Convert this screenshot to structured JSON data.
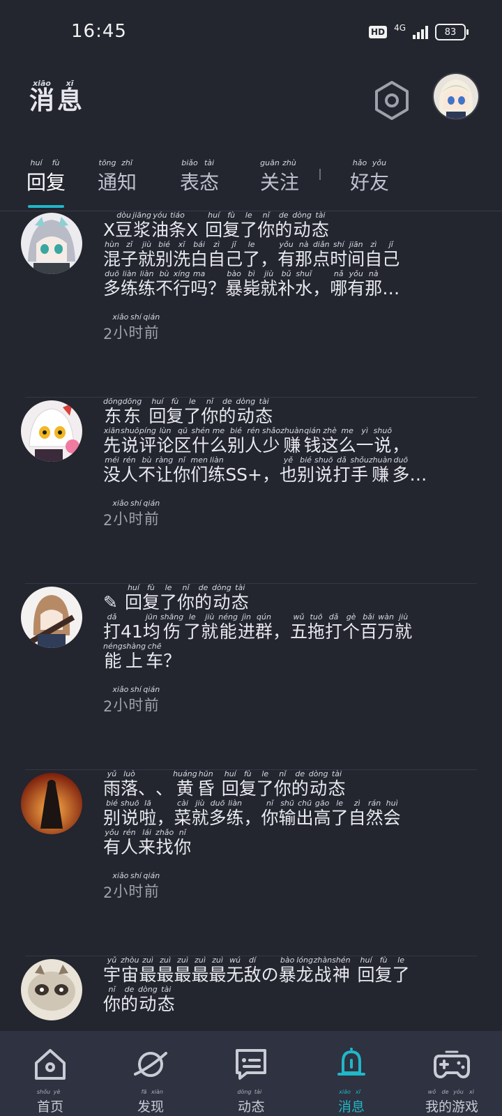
{
  "status_bar": {
    "time": "16:45",
    "hd": "HD",
    "network": "4G",
    "battery": "83"
  },
  "header": {
    "title": [
      {
        "char": "消",
        "py": "xiāo"
      },
      {
        "char": "息",
        "py": "xī"
      }
    ]
  },
  "tabs": [
    {
      "chars": [
        {
          "char": "回",
          "py": "huí"
        },
        {
          "char": "复",
          "py": "fù"
        }
      ],
      "active": true
    },
    {
      "chars": [
        {
          "char": "通",
          "py": "tōng"
        },
        {
          "char": "知",
          "py": "zhī"
        }
      ],
      "active": false
    },
    {
      "chars": [
        {
          "char": "表",
          "py": "biǎo"
        },
        {
          "char": "态",
          "py": "tài"
        }
      ],
      "active": false
    },
    {
      "chars": [
        {
          "char": "关",
          "py": "guān"
        },
        {
          "char": "注",
          "py": "zhù"
        }
      ],
      "active": false
    },
    {
      "chars": [
        {
          "char": "好",
          "py": "hǎo"
        },
        {
          "char": "友",
          "py": "yǒu"
        }
      ],
      "active": false
    }
  ],
  "messages": [
    {
      "lines": [
        [
          {
            "char": "X",
            "py": ""
          },
          {
            "char": "豆",
            "py": "dòu"
          },
          {
            "char": "浆",
            "py": "jiāng"
          },
          {
            "char": "油",
            "py": "yóu"
          },
          {
            "char": "条",
            "py": "tiáo"
          },
          {
            "char": "X",
            "py": ""
          },
          {
            "char": " ",
            "py": ""
          },
          {
            "char": "回",
            "py": "huí"
          },
          {
            "char": "复",
            "py": "fù"
          },
          {
            "char": "了",
            "py": "le"
          },
          {
            "char": "你",
            "py": "nǐ"
          },
          {
            "char": "的",
            "py": "de"
          },
          {
            "char": "动",
            "py": "dòng"
          },
          {
            "char": "态",
            "py": "tài"
          }
        ],
        [
          {
            "char": "混",
            "py": "hùn"
          },
          {
            "char": "子",
            "py": "zǐ"
          },
          {
            "char": "就",
            "py": "jiù"
          },
          {
            "char": "别",
            "py": "bié"
          },
          {
            "char": "洗",
            "py": "xǐ"
          },
          {
            "char": "白",
            "py": "bái"
          },
          {
            "char": "自",
            "py": "zì"
          },
          {
            "char": "己",
            "py": "jǐ"
          },
          {
            "char": "了",
            "py": "le"
          },
          {
            "char": "，",
            "py": ""
          },
          {
            "char": "有",
            "py": "yǒu"
          },
          {
            "char": "那",
            "py": "nà"
          },
          {
            "char": "点",
            "py": "diǎn"
          },
          {
            "char": "时",
            "py": "shí"
          },
          {
            "char": "间",
            "py": "jiān"
          },
          {
            "char": "自",
            "py": "zì"
          },
          {
            "char": "己",
            "py": "jǐ"
          }
        ],
        [
          {
            "char": "多",
            "py": "duō"
          },
          {
            "char": "练",
            "py": "liàn"
          },
          {
            "char": "练",
            "py": "liàn"
          },
          {
            "char": "不",
            "py": "bù"
          },
          {
            "char": "行",
            "py": "xíng"
          },
          {
            "char": "吗",
            "py": "ma"
          },
          {
            "char": "？",
            "py": ""
          },
          {
            "char": "暴",
            "py": "bào"
          },
          {
            "char": "毙",
            "py": "bì"
          },
          {
            "char": "就",
            "py": "jiù"
          },
          {
            "char": "补",
            "py": "bǔ"
          },
          {
            "char": "水",
            "py": "shuǐ"
          },
          {
            "char": "，",
            "py": ""
          },
          {
            "char": "哪",
            "py": "nǎ"
          },
          {
            "char": "有",
            "py": "yǒu"
          },
          {
            "char": "那",
            "py": "nà"
          },
          {
            "char": "…",
            "py": ""
          }
        ]
      ],
      "time": [
        {
          "char": "2",
          "py": ""
        },
        {
          "char": "小",
          "py": "xiǎo"
        },
        {
          "char": "时",
          "py": "shí"
        },
        {
          "char": "前",
          "py": "qián"
        }
      ]
    },
    {
      "lines": [
        [
          {
            "char": "东",
            "py": "dōng"
          },
          {
            "char": "东",
            "py": "dōng"
          },
          {
            "char": " ",
            "py": ""
          },
          {
            "char": "回",
            "py": "huí"
          },
          {
            "char": "复",
            "py": "fù"
          },
          {
            "char": "了",
            "py": "le"
          },
          {
            "char": "你",
            "py": "nǐ"
          },
          {
            "char": "的",
            "py": "de"
          },
          {
            "char": "动",
            "py": "dòng"
          },
          {
            "char": "态",
            "py": "tài"
          }
        ],
        [
          {
            "char": "先",
            "py": "xiān"
          },
          {
            "char": "说",
            "py": "shuō"
          },
          {
            "char": "评",
            "py": "píng"
          },
          {
            "char": "论",
            "py": "lùn"
          },
          {
            "char": "区",
            "py": "qū"
          },
          {
            "char": "什",
            "py": "shén"
          },
          {
            "char": "么",
            "py": "me"
          },
          {
            "char": "别",
            "py": "bié"
          },
          {
            "char": "人",
            "py": "rén"
          },
          {
            "char": "少",
            "py": "shǎo"
          },
          {
            "char": "赚",
            "py": "zhuàn"
          },
          {
            "char": "钱",
            "py": "qián"
          },
          {
            "char": "这",
            "py": "zhè"
          },
          {
            "char": "么",
            "py": "me"
          },
          {
            "char": "一",
            "py": "yì"
          },
          {
            "char": "说",
            "py": "shuō"
          },
          {
            "char": "，",
            "py": ""
          }
        ],
        [
          {
            "char": "没",
            "py": "méi"
          },
          {
            "char": "人",
            "py": "rén"
          },
          {
            "char": "不",
            "py": "bù"
          },
          {
            "char": "让",
            "py": "ràng"
          },
          {
            "char": "你",
            "py": "nǐ"
          },
          {
            "char": "们",
            "py": "men"
          },
          {
            "char": "练",
            "py": "liàn"
          },
          {
            "char": "SS+",
            "py": ""
          },
          {
            "char": "，",
            "py": ""
          },
          {
            "char": "也",
            "py": "yě"
          },
          {
            "char": "别",
            "py": "bié"
          },
          {
            "char": "说",
            "py": "shuō"
          },
          {
            "char": "打",
            "py": "dǎ"
          },
          {
            "char": "手",
            "py": "shǒu"
          },
          {
            "char": "赚",
            "py": "zhuàn"
          },
          {
            "char": "多",
            "py": "duō"
          },
          {
            "char": "…",
            "py": ""
          }
        ]
      ],
      "time": [
        {
          "char": "2",
          "py": ""
        },
        {
          "char": "小",
          "py": "xiǎo"
        },
        {
          "char": "时",
          "py": "shí"
        },
        {
          "char": "前",
          "py": "qián"
        }
      ]
    },
    {
      "lines": [
        [
          {
            "char": "✎",
            "py": ""
          },
          {
            "char": " ",
            "py": ""
          },
          {
            "char": "回",
            "py": "huí"
          },
          {
            "char": "复",
            "py": "fù"
          },
          {
            "char": "了",
            "py": "le"
          },
          {
            "char": "你",
            "py": "nǐ"
          },
          {
            "char": "的",
            "py": "de"
          },
          {
            "char": "动",
            "py": "dòng"
          },
          {
            "char": "态",
            "py": "tài"
          }
        ],
        [
          {
            "char": "打",
            "py": "dǎ"
          },
          {
            "char": "41",
            "py": ""
          },
          {
            "char": "均",
            "py": "jūn"
          },
          {
            "char": "伤",
            "py": "shāng"
          },
          {
            "char": "了",
            "py": "le"
          },
          {
            "char": "就",
            "py": "jiù"
          },
          {
            "char": "能",
            "py": "néng"
          },
          {
            "char": "进",
            "py": "jìn"
          },
          {
            "char": "群",
            "py": "qún"
          },
          {
            "char": "，",
            "py": ""
          },
          {
            "char": "五",
            "py": "wǔ"
          },
          {
            "char": "拖",
            "py": "tuō"
          },
          {
            "char": "打",
            "py": "dǎ"
          },
          {
            "char": "个",
            "py": "gè"
          },
          {
            "char": "百",
            "py": "bǎi"
          },
          {
            "char": "万",
            "py": "wàn"
          },
          {
            "char": "就",
            "py": "jiù"
          }
        ],
        [
          {
            "char": "能",
            "py": "néng"
          },
          {
            "char": "上",
            "py": "shàng"
          },
          {
            "char": "车",
            "py": "chē"
          },
          {
            "char": "？",
            "py": ""
          }
        ]
      ],
      "time": [
        {
          "char": "2",
          "py": ""
        },
        {
          "char": "小",
          "py": "xiǎo"
        },
        {
          "char": "时",
          "py": "shí"
        },
        {
          "char": "前",
          "py": "qián"
        }
      ]
    },
    {
      "lines": [
        [
          {
            "char": "雨",
            "py": "yǔ"
          },
          {
            "char": "落",
            "py": "luò"
          },
          {
            "char": "、",
            "py": ""
          },
          {
            "char": "、",
            "py": ""
          },
          {
            "char": "黄",
            "py": "huáng"
          },
          {
            "char": "昏",
            "py": "hūn"
          },
          {
            "char": " ",
            "py": ""
          },
          {
            "char": "回",
            "py": "huí"
          },
          {
            "char": "复",
            "py": "fù"
          },
          {
            "char": "了",
            "py": "le"
          },
          {
            "char": "你",
            "py": "nǐ"
          },
          {
            "char": "的",
            "py": "de"
          },
          {
            "char": "动",
            "py": "dòng"
          },
          {
            "char": "态",
            "py": "tài"
          }
        ],
        [
          {
            "char": "别",
            "py": "bié"
          },
          {
            "char": "说",
            "py": "shuō"
          },
          {
            "char": "啦",
            "py": "lā"
          },
          {
            "char": "，",
            "py": ""
          },
          {
            "char": "菜",
            "py": "cài"
          },
          {
            "char": "就",
            "py": "jiù"
          },
          {
            "char": "多",
            "py": "duō"
          },
          {
            "char": "练",
            "py": "liàn"
          },
          {
            "char": "，",
            "py": ""
          },
          {
            "char": "你",
            "py": "nǐ"
          },
          {
            "char": "输",
            "py": "shū"
          },
          {
            "char": "出",
            "py": "chū"
          },
          {
            "char": "高",
            "py": "gāo"
          },
          {
            "char": "了",
            "py": "le"
          },
          {
            "char": "自",
            "py": "zì"
          },
          {
            "char": "然",
            "py": "rán"
          },
          {
            "char": "会",
            "py": "huì"
          }
        ],
        [
          {
            "char": "有",
            "py": "yǒu"
          },
          {
            "char": "人",
            "py": "rén"
          },
          {
            "char": "来",
            "py": "lái"
          },
          {
            "char": "找",
            "py": "zhǎo"
          },
          {
            "char": "你",
            "py": "nǐ"
          }
        ]
      ],
      "time": [
        {
          "char": "2",
          "py": ""
        },
        {
          "char": "小",
          "py": "xiǎo"
        },
        {
          "char": "时",
          "py": "shí"
        },
        {
          "char": "前",
          "py": "qián"
        }
      ]
    },
    {
      "lines": [
        [
          {
            "char": "宇",
            "py": "yǔ"
          },
          {
            "char": "宙",
            "py": "zhòu"
          },
          {
            "char": "最",
            "py": "zuì"
          },
          {
            "char": "最",
            "py": "zuì"
          },
          {
            "char": "最",
            "py": "zuì"
          },
          {
            "char": "最",
            "py": "zuì"
          },
          {
            "char": "最",
            "py": "zuì"
          },
          {
            "char": "无",
            "py": "wú"
          },
          {
            "char": "敌",
            "py": "dí"
          },
          {
            "char": "の",
            "py": ""
          },
          {
            "char": "暴",
            "py": "bào"
          },
          {
            "char": "龙",
            "py": "lóng"
          },
          {
            "char": "战",
            "py": "zhàn"
          },
          {
            "char": "神",
            "py": "shén"
          },
          {
            "char": " ",
            "py": ""
          },
          {
            "char": "回",
            "py": "huí"
          },
          {
            "char": "复",
            "py": "fù"
          },
          {
            "char": "了",
            "py": "le"
          }
        ],
        [
          {
            "char": "你",
            "py": "nǐ"
          },
          {
            "char": "的",
            "py": "de"
          },
          {
            "char": "动",
            "py": "dòng"
          },
          {
            "char": "态",
            "py": "tài"
          }
        ]
      ],
      "time": []
    }
  ],
  "bottom_nav": [
    {
      "icon": "home-icon",
      "chars": [
        {
          "char": "首",
          "py": "shǒu"
        },
        {
          "char": "页",
          "py": "yè"
        }
      ],
      "active": false
    },
    {
      "icon": "planet-icon",
      "chars": [
        {
          "char": "发",
          "py": "fā"
        },
        {
          "char": "现",
          "py": "xiàn"
        }
      ],
      "active": false
    },
    {
      "icon": "chat-icon",
      "chars": [
        {
          "char": "动",
          "py": "dòng"
        },
        {
          "char": "态",
          "py": "tài"
        }
      ],
      "active": false
    },
    {
      "icon": "bell-icon",
      "chars": [
        {
          "char": "消",
          "py": "xiāo"
        },
        {
          "char": "息",
          "py": "xī"
        }
      ],
      "active": true
    },
    {
      "icon": "gamepad-icon",
      "chars": [
        {
          "char": "我",
          "py": "wǒ"
        },
        {
          "char": "的",
          "py": "de"
        },
        {
          "char": "游",
          "py": "yóu"
        },
        {
          "char": "戏",
          "py": "xì"
        }
      ],
      "active": false
    }
  ],
  "colors": {
    "accent": "#20b7c8",
    "background": "#23252f",
    "nav_bg": "#2e3241"
  }
}
